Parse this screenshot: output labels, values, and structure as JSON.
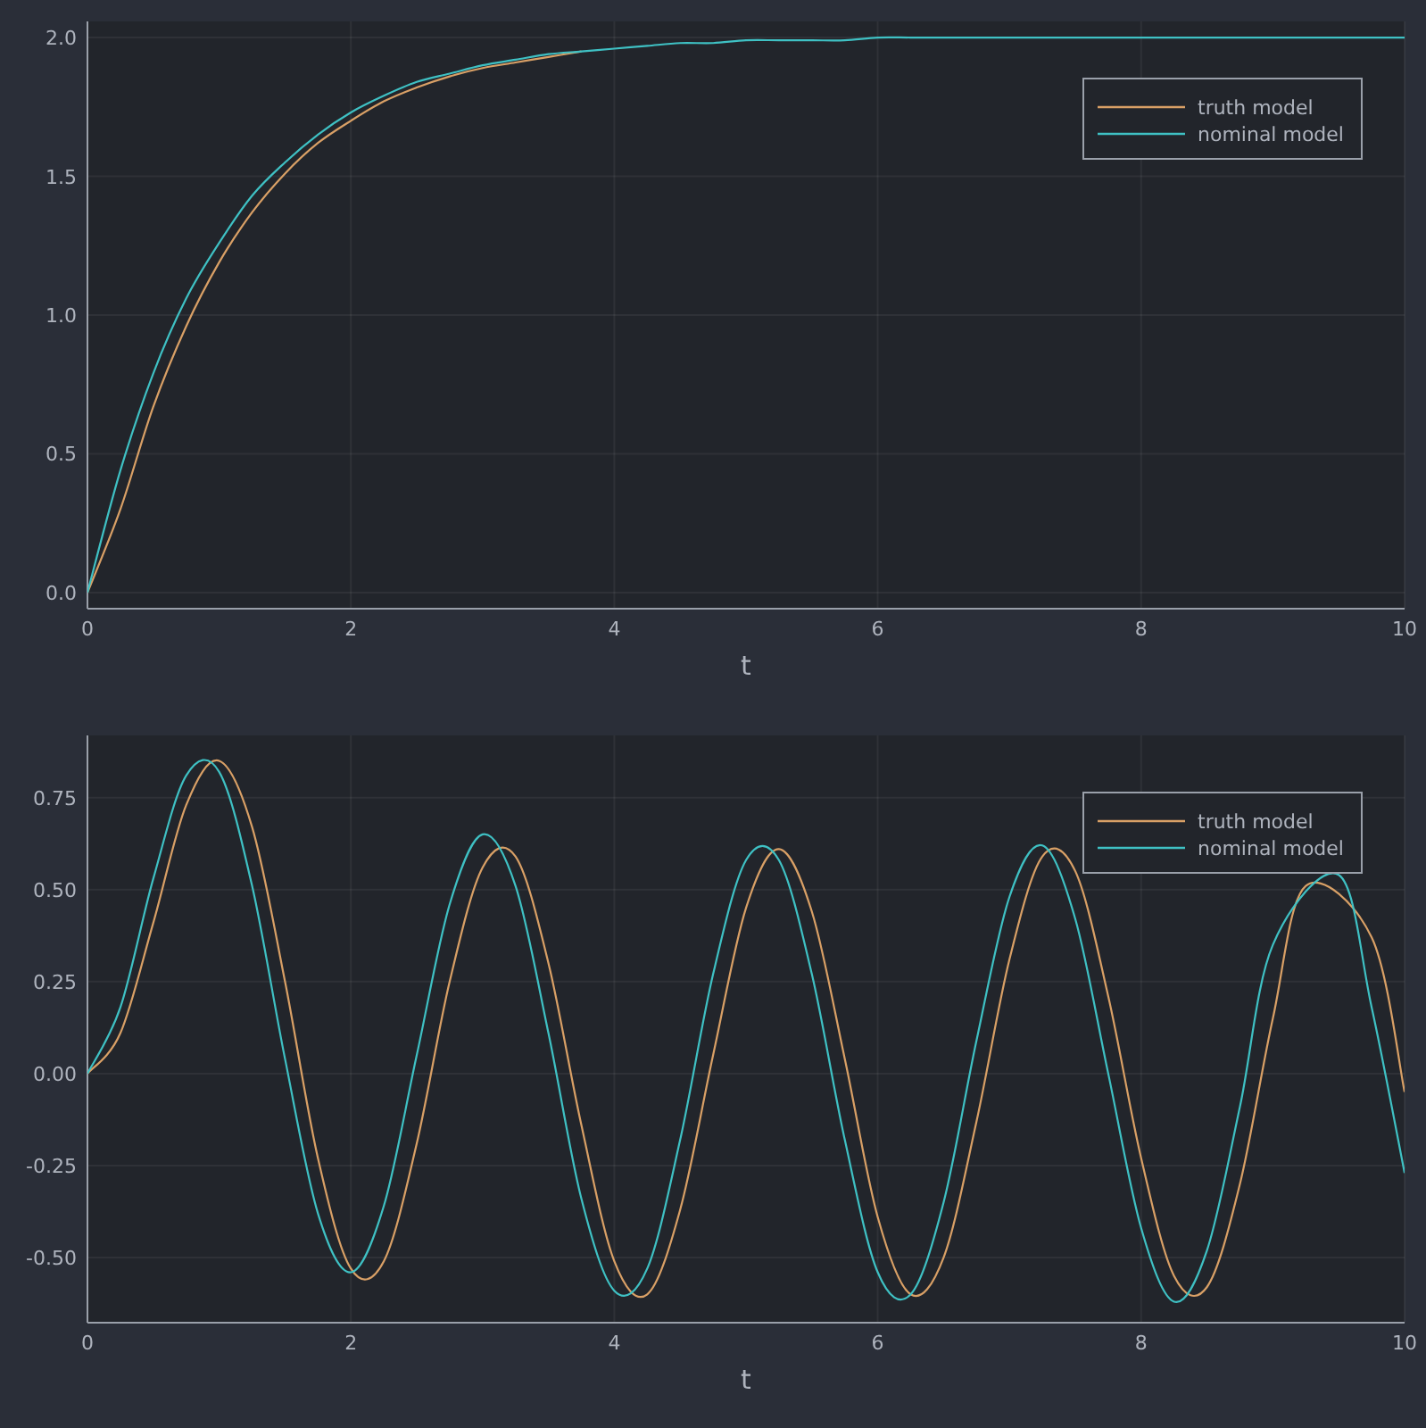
{
  "plots": [
    {
      "chart_data": {
        "type": "line",
        "grid": true,
        "legend": true,
        "xlabel": "t",
        "x": [
          0,
          0.25,
          0.5,
          0.75,
          1,
          1.25,
          1.5,
          1.75,
          2,
          2.25,
          2.5,
          2.75,
          3,
          3.25,
          3.5,
          3.75,
          4,
          4.25,
          4.5,
          4.75,
          5,
          5.25,
          5.5,
          5.75,
          6,
          6.25,
          6.5,
          6.75,
          7,
          7.25,
          7.5,
          7.75,
          8,
          8.25,
          8.5,
          8.75,
          9,
          9.25,
          9.5,
          9.75,
          10
        ],
        "xlim": [
          0,
          10
        ],
        "ylim": [
          -0.058,
          2.058
        ],
        "xticks": [
          0,
          2,
          4,
          6,
          8,
          10
        ],
        "yticks": [
          {
            "value": 0,
            "label": "0.0"
          },
          {
            "value": 0.5,
            "label": "0.5"
          },
          {
            "value": 1,
            "label": "1.0"
          },
          {
            "value": 1.5,
            "label": "1.5"
          },
          {
            "value": 2,
            "label": "2.0"
          }
        ],
        "series": [
          {
            "name": "truth model",
            "color": "#d9a066",
            "values": [
              0,
              0.3,
              0.67,
              0.96,
              1.19,
              1.37,
              1.51,
              1.62,
              1.7,
              1.77,
              1.82,
              1.86,
              1.89,
              1.91,
              1.93,
              1.95,
              null,
              null,
              null,
              null,
              null,
              null,
              null,
              null,
              null,
              null,
              null,
              null,
              null,
              null,
              null,
              null,
              null,
              null,
              null,
              null,
              null,
              null,
              null,
              null,
              null
            ]
          },
          {
            "name": "nominal model",
            "color": "#3fc1c4",
            "values": [
              0,
              0.44,
              0.79,
              1.06,
              1.26,
              1.43,
              1.55,
              1.65,
              1.73,
              1.79,
              1.84,
              1.87,
              1.9,
              1.92,
              1.94,
              1.95,
              1.96,
              1.97,
              1.98,
              1.98,
              1.99,
              1.99,
              1.99,
              1.99,
              2.0,
              2.0,
              2.0,
              2.0,
              2.0,
              2.0,
              2.0,
              2.0,
              2.0,
              2.0,
              2.0,
              2.0,
              2.0,
              2.0,
              2.0,
              2.0,
              2.0
            ]
          }
        ]
      }
    },
    {
      "chart_data": {
        "type": "line",
        "grid": true,
        "legend": true,
        "xlabel": "t",
        "x": [
          0,
          0.25,
          0.5,
          0.75,
          1,
          1.25,
          1.5,
          1.75,
          2,
          2.25,
          2.5,
          2.75,
          3,
          3.25,
          3.5,
          3.75,
          4,
          4.25,
          4.5,
          4.75,
          5,
          5.25,
          5.5,
          5.75,
          6,
          6.25,
          6.5,
          6.75,
          7,
          7.25,
          7.5,
          7.75,
          8,
          8.25,
          8.5,
          8.75,
          9,
          9.25,
          9.5,
          9.75,
          10
        ],
        "xlim": [
          0,
          10
        ],
        "ylim": [
          -0.677,
          0.919
        ],
        "xticks": [
          0,
          2,
          4,
          6,
          8,
          10
        ],
        "yticks": [
          {
            "value": -0.5,
            "label": "-0.50"
          },
          {
            "value": -0.25,
            "label": "-0.25"
          },
          {
            "value": 0,
            "label": "0.00"
          },
          {
            "value": 0.25,
            "label": "0.25"
          },
          {
            "value": 0.5,
            "label": "0.50"
          },
          {
            "value": 0.75,
            "label": "0.75"
          }
        ],
        "series": [
          {
            "name": "truth model",
            "color": "#d9a066",
            "values": [
              0,
              0.11,
              0.41,
              0.73,
              0.85,
              0.67,
              0.25,
              -0.23,
              -0.53,
              -0.51,
              -0.19,
              0.25,
              0.56,
              0.59,
              0.3,
              -0.14,
              -0.51,
              -0.6,
              -0.37,
              0.05,
              0.45,
              0.61,
              0.44,
              0.04,
              -0.39,
              -0.6,
              -0.5,
              -0.13,
              0.31,
              0.59,
              0.55,
              0.21,
              -0.23,
              -0.55,
              -0.58,
              -0.3,
              0.15,
              0.51,
              null,
              0.37,
              -0.05
            ]
          },
          {
            "name": "nominal model",
            "color": "#3fc1c4",
            "values": [
              0,
              0.18,
              0.53,
              0.81,
              0.82,
              0.51,
              0.04,
              -0.38,
              -0.54,
              -0.36,
              0.05,
              0.46,
              0.65,
              0.51,
              0.11,
              -0.34,
              -0.59,
              -0.53,
              -0.18,
              0.27,
              0.58,
              0.58,
              0.27,
              -0.18,
              -0.54,
              -0.6,
              -0.35,
              0.09,
              0.48,
              0.62,
              0.42,
              0,
              -0.42,
              -0.62,
              -0.48,
              -0.09,
              0.35,
              null,
              0.54,
              0.18,
              -0.27
            ]
          }
        ]
      }
    }
  ]
}
